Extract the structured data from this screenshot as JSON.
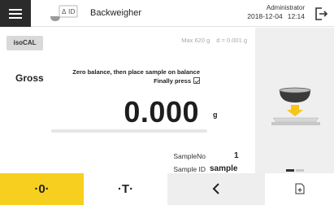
{
  "header": {
    "app_title": "Backweigher",
    "app_icon_text": "Δ ID",
    "user": "Administrator",
    "date": "2018-12-04",
    "time": "12:14"
  },
  "main": {
    "isocal_label": "isoCAL",
    "max_capacity": "Max 620 g",
    "readability": "d = 0.001 g",
    "mode_label": "Gross",
    "instruction_line1": "Zero balance, then place sample on balance",
    "instruction_line2": "Finally press",
    "weight_value": "0.000",
    "weight_unit": "g",
    "progress": 0.0,
    "sample_no_label": "SampleNo",
    "sample_no_value": "1",
    "sample_id_label": "Sample ID",
    "sample_id_value": "sample"
  },
  "side": {
    "pager": {
      "pages": 2,
      "active": 1
    }
  },
  "bottom_bar": {
    "zero_label": "·0·",
    "tare_label": "·T·",
    "back_label": "<",
    "doc_icon": "document-plus-icon"
  },
  "colors": {
    "accent_yellow": "#f7cf1e",
    "header_dark": "#2b2b2b",
    "panel_gray": "#efefef"
  }
}
